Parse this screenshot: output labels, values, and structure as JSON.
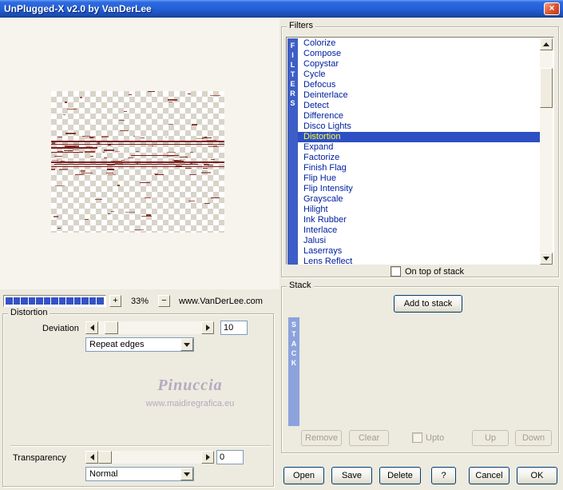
{
  "window": {
    "title": "UnPlugged-X v2.0 by VanDerLee",
    "close_label": "×"
  },
  "preview": {
    "zoom_in_label": "+",
    "zoom_value": "33%",
    "zoom_out_label": "−",
    "website": "www.VanDerLee.com",
    "progress_segments": 13,
    "watermark_title": "Pinuccia",
    "watermark_url": "www.maidiregrafica.eu"
  },
  "filters_panel": {
    "group_label": "Filters",
    "vertical_label": "FILTERS",
    "items": [
      "Colorize",
      "Compose",
      "Copystar",
      "Cycle",
      "Defocus",
      "Deinterlace",
      "Detect",
      "Difference",
      "Disco Lights",
      "Distortion",
      "Expand",
      "Factorize",
      "Finish Flag",
      "Flip Hue",
      "Flip Intensity",
      "Grayscale",
      "Hilight",
      "Ink Rubber",
      "Interlace",
      "Jalusi",
      "Laserrays",
      "Lens Reflect"
    ],
    "selected": "Distortion",
    "on_top_label": "On top of stack"
  },
  "distortion_panel": {
    "group_label": "Distortion",
    "deviation_label": "Deviation",
    "deviation_value": "10",
    "edge_mode": "Repeat edges",
    "transparency_label": "Transparency",
    "transparency_value": "0",
    "blend_mode": "Normal"
  },
  "stack_panel": {
    "group_label": "Stack",
    "vertical_label": "STACK",
    "add_button": "Add to stack",
    "remove_button": "Remove",
    "clear_button": "Clear",
    "upto_label": "Upto",
    "up_button": "Up",
    "down_button": "Down"
  },
  "footer": {
    "open": "Open",
    "save": "Save",
    "delete": "Delete",
    "help": "?",
    "cancel": "Cancel",
    "ok": "OK"
  },
  "colors": {
    "dialog_bg": "#EDEADF",
    "title_blue": "#2360D8",
    "close_red": "#C03A12",
    "selection_bg": "#2E4FC4",
    "selection_text": "#FFFF30",
    "filter_text": "#0020A0",
    "filters_bar": "#3D5EC6",
    "stack_bar": "#8CA2DC",
    "progress_fill": "#3552C4",
    "watermark": "#B4AAC2"
  }
}
